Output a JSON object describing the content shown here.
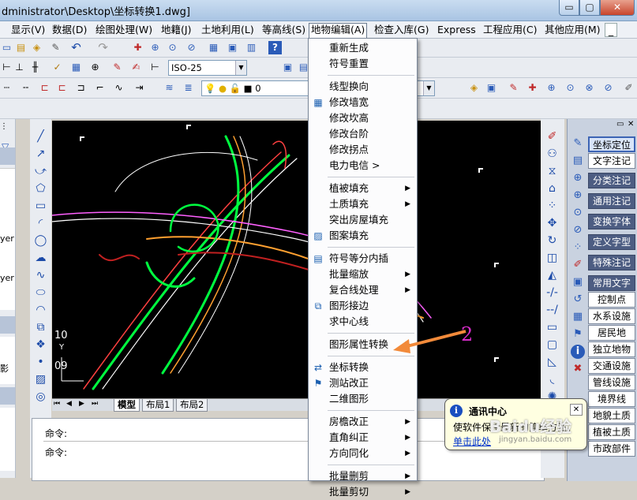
{
  "window": {
    "title": "dministrator\\Desktop\\坐标转换1.dwg]",
    "min_glyph": "▭",
    "max_glyph": "▢",
    "close_glyph": "✕"
  },
  "menubar": {
    "items": [
      "显示(V)",
      "数据(D)",
      "绘图处理(W)",
      "地籍(J)",
      "土地利用(L)",
      "等高线(S)",
      "地物编辑(A)",
      "检查入库(G)",
      "Express",
      "工程应用(C)",
      "其他应用(M)"
    ],
    "active": "地物编辑(A)",
    "restore_glyph": "_"
  },
  "toolbar": {
    "textstyle_value": "ISO-25",
    "layer_value": "0"
  },
  "left_panel": {
    "labels": [
      "yer",
      "yer",
      "影"
    ]
  },
  "canvas": {
    "coord_top": "10",
    "coord_axis": "Y",
    "coord_bottom": "09"
  },
  "tabs": [
    "模型",
    "布局1",
    "布局2"
  ],
  "command": {
    "line1": "命令:",
    "line2": "命令:"
  },
  "dropdown": {
    "items": [
      {
        "label": "重新生成",
        "icon": "",
        "sub": false
      },
      {
        "label": "符号重置",
        "icon": "",
        "sub": false
      },
      {
        "sep": true
      },
      {
        "label": "线型换向",
        "icon": "",
        "sub": false
      },
      {
        "label": "修改墙宽",
        "icon": "grid-icon",
        "sub": false
      },
      {
        "label": "修改坎高",
        "icon": "",
        "sub": false
      },
      {
        "label": "修改台阶",
        "icon": "",
        "sub": false
      },
      {
        "label": "修改拐点",
        "icon": "",
        "sub": false
      },
      {
        "label": "电力电信 >",
        "icon": "",
        "sub": false
      },
      {
        "sep": true
      },
      {
        "label": "植被填充",
        "icon": "",
        "sub": true
      },
      {
        "label": "土质填充",
        "icon": "",
        "sub": true
      },
      {
        "label": "突出房屋填充",
        "icon": "",
        "sub": false
      },
      {
        "label": "图案填充",
        "icon": "hatch-icon",
        "sub": false
      },
      {
        "sep": true
      },
      {
        "label": "符号等分内插",
        "icon": "interp-icon",
        "sub": false
      },
      {
        "label": "批量缩放",
        "icon": "",
        "sub": true
      },
      {
        "label": "复合线处理",
        "icon": "",
        "sub": true
      },
      {
        "label": "图形接边",
        "icon": "join-icon",
        "sub": false
      },
      {
        "label": "求中心线",
        "icon": "",
        "sub": false
      },
      {
        "sep": true
      },
      {
        "label": "图形属性转换",
        "icon": "",
        "sub": true
      },
      {
        "sep": true
      },
      {
        "label": "坐标转换",
        "icon": "coord-icon",
        "sub": false
      },
      {
        "label": "测站改正",
        "icon": "station-icon",
        "sub": false
      },
      {
        "label": "二维图形",
        "icon": "",
        "sub": false
      },
      {
        "sep": true
      },
      {
        "label": "房檐改正",
        "icon": "",
        "sub": true
      },
      {
        "label": "直角纠正",
        "icon": "",
        "sub": true
      },
      {
        "label": "方向同化",
        "icon": "",
        "sub": true
      },
      {
        "sep": true
      },
      {
        "label": "批量删剪",
        "icon": "",
        "sub": true
      },
      {
        "label": "批量剪切",
        "icon": "",
        "sub": true
      }
    ],
    "sub_glyph": "▶"
  },
  "annotation": {
    "number": "2"
  },
  "right_panel": {
    "header_close": "✕",
    "buttons": [
      {
        "label": "坐标定位",
        "style": "hi"
      },
      {
        "label": "文字注记",
        "style": "light"
      },
      {
        "label": "分类注记",
        "style": "dark"
      },
      {
        "label": "通用注记",
        "style": "dark"
      },
      {
        "label": "变换字体",
        "style": "dark"
      },
      {
        "label": "定义字型",
        "style": "dark"
      },
      {
        "label": "特殊注记",
        "style": "dark"
      },
      {
        "label": "常用文字",
        "style": "dark"
      },
      {
        "label": "控制点",
        "style": "light"
      },
      {
        "label": "水系设施",
        "style": "light"
      },
      {
        "label": "居民地",
        "style": "light"
      },
      {
        "label": "独立地物",
        "style": "light"
      },
      {
        "label": "交通设施",
        "style": "light"
      },
      {
        "label": "管线设施",
        "style": "light"
      },
      {
        "label": "境界线",
        "style": "light"
      },
      {
        "label": "地貌土质",
        "style": "light"
      },
      {
        "label": "植被土质",
        "style": "light"
      },
      {
        "label": "市政部件",
        "style": "light"
      }
    ]
  },
  "balloon": {
    "title": "通讯中心",
    "body": "使软件保持最新的简单方法。",
    "link": "单击此处",
    "close": "✕",
    "info_glyph": "i"
  },
  "watermark": {
    "text": "Baidu经验",
    "sub": "jingyan.baidu.com"
  }
}
